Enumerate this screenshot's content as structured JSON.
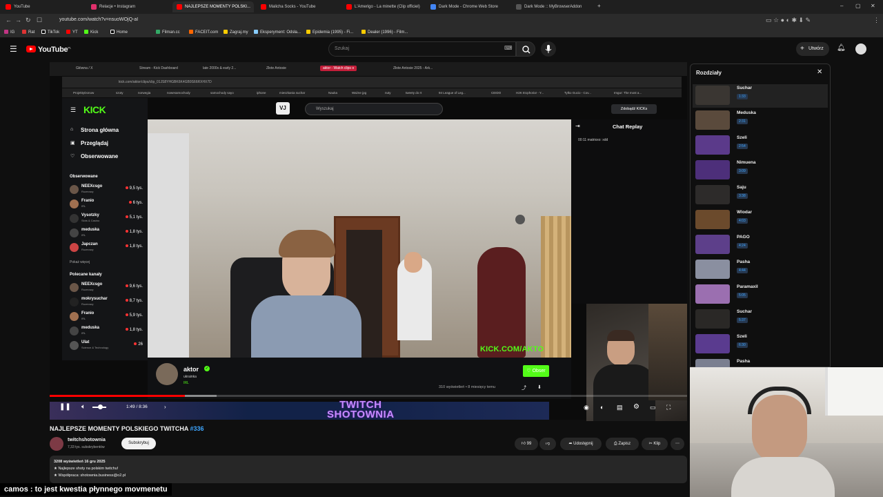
{
  "browser": {
    "tabs": [
      {
        "label": "YouTube",
        "color": "#ff0000"
      },
      {
        "label": "Relacje • Instagram",
        "color": "#e1306c"
      },
      {
        "label": "NAJLEPSZE MOMENTY POLSKI...",
        "color": "#ff0000"
      },
      {
        "label": "Malicha Socks - YouTube",
        "color": "#ff0000"
      },
      {
        "label": "L'Amerigo - La minette (Clip officiel)",
        "color": "#ff0000"
      },
      {
        "label": "Dark Mode - Chrome Web Store",
        "color": "#4285f4"
      },
      {
        "label": "Dark Mode :: MyBrowserAddon",
        "color": "#555555"
      }
    ],
    "url": "youtube.com/watch?v=nsuoWOjQ-aI",
    "bookmarks": [
      "IG",
      "Rat",
      "TikTok",
      "YT",
      "Kick",
      "Home",
      "Filman.cc",
      "FACEIT.com",
      "Zagraj.my",
      "Eksperyment: Odsła...",
      "Epidemia (1995) - Fi...",
      "Dealer (1996) - Film..."
    ]
  },
  "youtube": {
    "logo": "YouTube",
    "logo_region": "PL",
    "search_placeholder": "Szukaj",
    "create_label": "Utwórz"
  },
  "inner_browser": {
    "tabs": [
      "Główna / X",
      "Stream - Kick Dashboard",
      "late 2000s & early 2...",
      "Złote Antosie",
      "aktor - Watch clips o",
      "Złote Antosie 2025 - Ark..."
    ],
    "url": "kick.com/aktor/clips/clip_01JS8YHGBK6K4GB9S66RXHX7D",
    "bookmarks": [
      "ProjektyDonow",
      "szoty",
      "norwegia",
      "nowesamochody",
      "samochody sayo",
      "iphone",
      "mieszkania suchar",
      "Nauka",
      "Ważne jpg",
      "nuty",
      "tweety do rt",
      "94 League of Leg...",
      "CEIDO",
      "H2K EUphoria! - Y...",
      "Tylko Gucio - Cov...",
      "Imgur: The most a..."
    ]
  },
  "kick": {
    "logo": "KICK",
    "search_placeholder": "Wyszukaj",
    "nav": [
      "Strona główna",
      "Przeglądaj",
      "Obserwowane"
    ],
    "followed_title": "Obserwowane",
    "followed": [
      {
        "name": "NEEXcsgo",
        "cat": "Rozmowy",
        "viewers": "9,5 tys."
      },
      {
        "name": "Franio",
        "cat": "IRL",
        "viewers": "6 tys."
      },
      {
        "name": "Vysotzky",
        "cat": "Slots & Casino",
        "viewers": "5,1 tys."
      },
      {
        "name": "meduska",
        "cat": "IRL",
        "viewers": "1,8 tys."
      },
      {
        "name": "Japczan",
        "cat": "Rozmowy",
        "viewers": "1,8 tys."
      }
    ],
    "show_more": "Pokaż więcej",
    "recommended_title": "Polecane kanały",
    "recommended": [
      {
        "name": "NEEXcsgo",
        "cat": "Rozmowy",
        "viewers": "9,6 tys."
      },
      {
        "name": "mokrysuchar",
        "cat": "Rozmowy",
        "viewers": "8,7 tys."
      },
      {
        "name": "Franio",
        "cat": "IRL",
        "viewers": "5,9 tys."
      },
      {
        "name": "meduska",
        "cat": "IRL",
        "viewers": "1,8 tys."
      },
      {
        "name": "Ulat",
        "cat": "Science & Technology",
        "viewers": "26"
      }
    ],
    "get_kicks": "Zdobądź KICKs",
    "chat_title": "Chat Replay",
    "chat_line": "00:11 matrixxo: xdd",
    "overlay_text": "KICK.COM/AKTO",
    "streamer": "aktor",
    "streamer_lang": "ukrainka",
    "streamer_cat": "IRL",
    "follow_label": "Obser",
    "views": "310 wyświetleń • 8 miesięcy temu"
  },
  "player": {
    "time": "1:49 / 8:36",
    "progress": 0.212,
    "banner_line1": "TWITCH",
    "banner_line2": "SHOTOWNIA"
  },
  "video": {
    "title": "NAJLEPSZE MOMENTY POLSKIEGO TWITCHA",
    "tag": "#336",
    "channel": "twitchshotownia",
    "subs": "7,33 tys. subskrybentów",
    "subscribe": "Subskrybuj",
    "likes": "99",
    "share": "Udostępnij",
    "save": "Zapisz",
    "clip": "Klip",
    "desc_meta": "3208 wyświetleń  16 gru 2025",
    "desc_line1": "★ Najlepsze shoty na polskim twitchu!",
    "desc_line2": "★ Współpraca: shotownia.business@o2.pl"
  },
  "chapters": {
    "title": "Rozdziały",
    "items": [
      {
        "name": "Suchar",
        "time": "1:33",
        "color": "#3a3632"
      },
      {
        "name": "Meduska",
        "time": "2:31",
        "color": "#5a4a3c"
      },
      {
        "name": "Szeli",
        "time": "2:54",
        "color": "#5b3a8a"
      },
      {
        "name": "Nimuena",
        "time": "3:09",
        "color": "#4d2f7a"
      },
      {
        "name": "Saju",
        "time": "3:38",
        "color": "#2d2b2a"
      },
      {
        "name": "Wlodar",
        "time": "4:03",
        "color": "#6b4a2c"
      },
      {
        "name": "PAGO",
        "time": "4:24",
        "color": "#5d3f8a"
      },
      {
        "name": "Pasha",
        "time": "4:44",
        "color": "#8a8fa0"
      },
      {
        "name": "Paramaxil",
        "time": "5:05",
        "color": "#9b6fb0"
      },
      {
        "name": "Suchar",
        "time": "5:37",
        "color": "#2a2826"
      },
      {
        "name": "Szeli",
        "time": "6:30",
        "color": "#5a3b8f"
      },
      {
        "name": "Pasha",
        "time": "",
        "color": "#7a7f90"
      }
    ]
  },
  "subtitle": "camos : to jest kwestia płynnego movmenetu"
}
